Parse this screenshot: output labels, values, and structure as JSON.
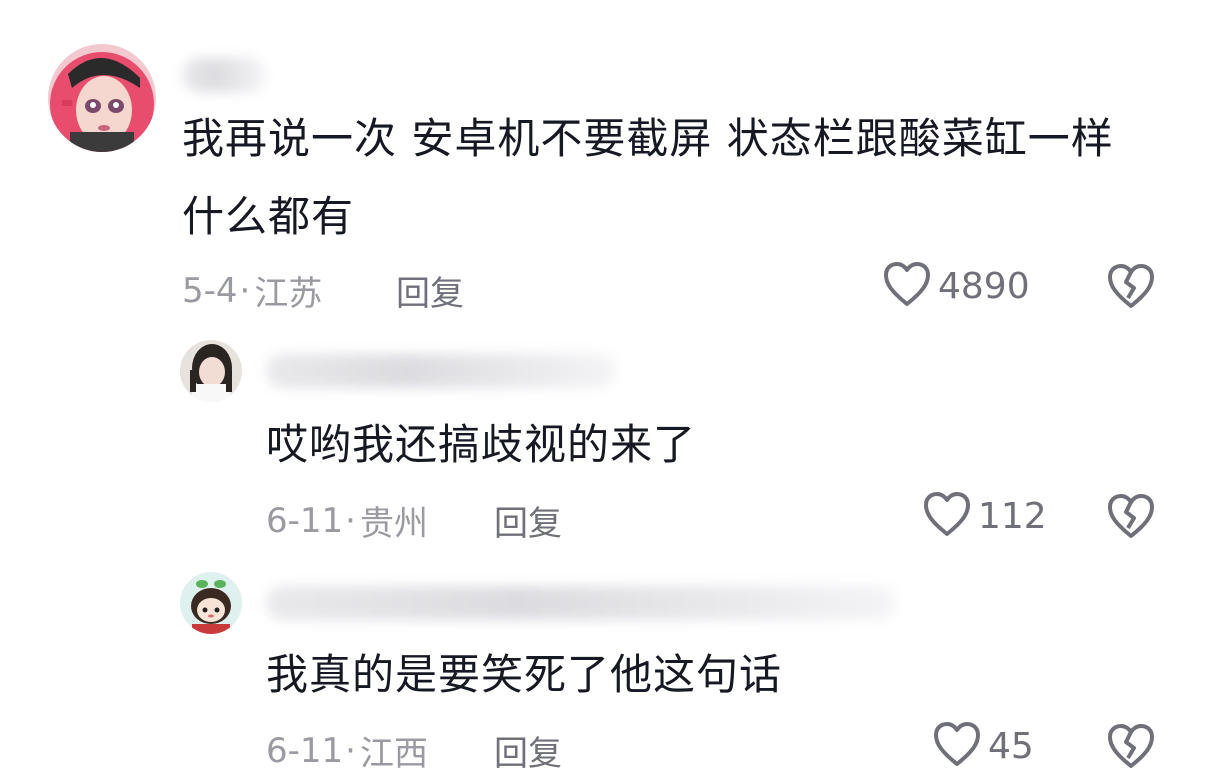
{
  "comments": [
    {
      "text_line1": "我再说一次 安卓机不要截屏 状态栏跟酸菜缸一样",
      "text_line2": "什么都有",
      "date": "5-4",
      "sep": "·",
      "location": "江苏",
      "reply_label": "回复",
      "like_count": "4890"
    },
    {
      "text_line1": "哎哟我还搞歧视的来了",
      "date": "6-11",
      "sep": "·",
      "location": "贵州",
      "reply_label": "回复",
      "like_count": "112"
    },
    {
      "text_line1": "我真的是要笑死了他这句话",
      "date": "6-11",
      "sep": "·",
      "location": "江西",
      "reply_label": "回复",
      "like_count": "45"
    }
  ],
  "icons": {
    "like": "heart-outline-icon",
    "dislike": "broken-heart-icon"
  },
  "colors": {
    "text": "#161823",
    "meta": "#9a9ba2",
    "action": "#6f7079"
  }
}
